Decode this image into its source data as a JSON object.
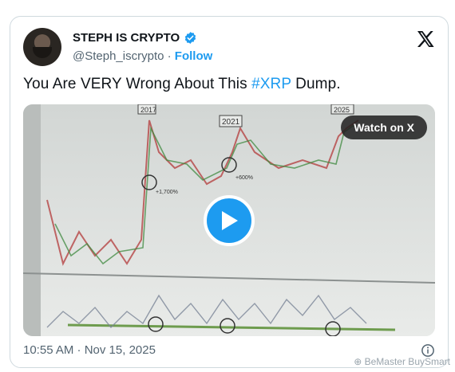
{
  "author": {
    "display_name": "STEPH IS CRYPTO",
    "handle": "@Steph_iscrypto",
    "separator": "·",
    "follow_label": "Follow"
  },
  "tweet": {
    "text_before": "You Are VERY Wrong About This ",
    "hashtag": "#XRP",
    "text_after": " Dump."
  },
  "media": {
    "watch_label": "Watch on X",
    "chart_labels": {
      "y2017": "2017",
      "y2021": "2021",
      "y2025": "2025",
      "pct1": "+1,700%",
      "pct2": "+600%"
    }
  },
  "footer": {
    "timestamp": "10:55 AM · Nov 15, 2025"
  },
  "watermark": {
    "text": "⊕ BeMaster BuySmart"
  },
  "colors": {
    "accent": "#1d9bf0",
    "border": "#cfd9de",
    "muted": "#536471"
  }
}
